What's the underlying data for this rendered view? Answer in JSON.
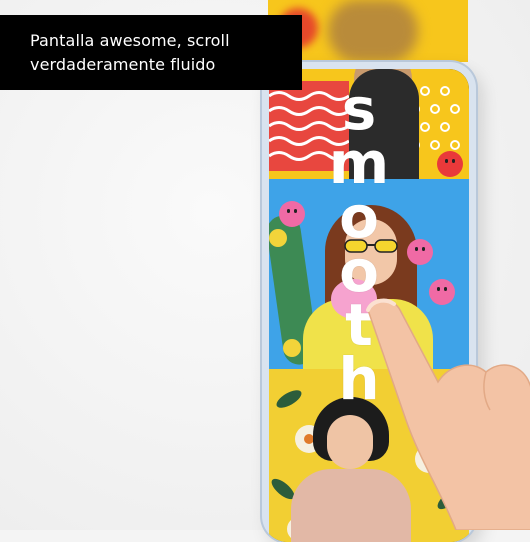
{
  "caption": {
    "line1": "Pantalla awesome, scroll",
    "line2": "verdaderamente fluido"
  },
  "screen_word": {
    "letters": [
      "s",
      "m",
      "o",
      "o",
      "t",
      "h"
    ]
  },
  "colors": {
    "caption_bg": "#000000",
    "caption_text": "#ffffff",
    "phone_frame": "#d9e3ef",
    "band_yellow": "#f7c61c",
    "band_blue": "#3ea3e8"
  }
}
